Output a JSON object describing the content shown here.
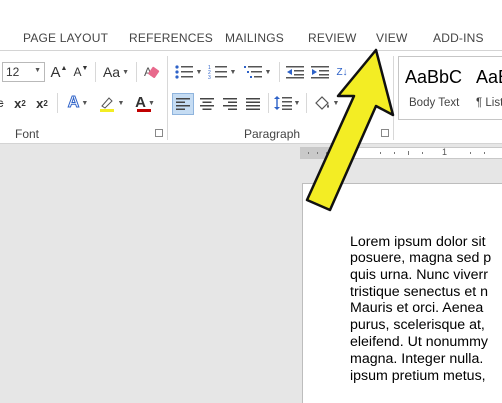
{
  "tabs": [
    "PAGE LAYOUT",
    "REFERENCES",
    "MAILINGS",
    "REVIEW",
    "VIEW",
    "ADD-INS"
  ],
  "font": {
    "size_value": "12",
    "grow_icon_text": "A",
    "shrink_icon_text": "A",
    "change_case_text": "Aa",
    "strike_text": "abc",
    "subscript_text": "x",
    "subscript_mark": "2",
    "superscript_text": "x",
    "superscript_mark": "2",
    "text_effects_text": "A",
    "font_color_text": "A",
    "group_label": "Font"
  },
  "paragraph": {
    "group_label": "Paragraph"
  },
  "styles": [
    {
      "sample": "AaBbC",
      "name": "Body Text"
    },
    {
      "sample": "AaB",
      "name": "¶ List"
    }
  ],
  "ruler": {
    "marker_1": "1"
  },
  "document": {
    "lines": [
      "Lorem ipsum dolor sit",
      "posuere, magna sed p",
      "quis urna. Nunc viverr",
      "tristique senectus et n",
      "Mauris et orci. Aenea",
      "purus, scelerisque at,",
      "eleifend. Ut nonummy",
      "magna. Integer nulla.",
      "ipsum pretium metus,"
    ]
  },
  "colors": {
    "arrow_fill": "#f3ed24",
    "arrow_stroke": "#111111",
    "font_color_bar": "#c00000",
    "highlight_blue": "#2e62c8",
    "selected_button": "#c5dcf3"
  }
}
